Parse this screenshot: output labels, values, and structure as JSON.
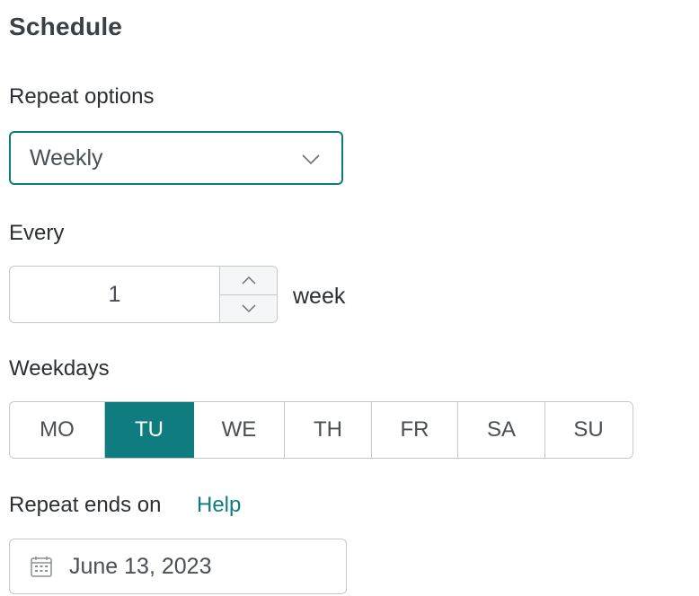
{
  "title": "Schedule",
  "repeat": {
    "label": "Repeat options",
    "selected": "Weekly",
    "icon": "chevron-down-icon"
  },
  "every": {
    "label": "Every",
    "value": "1",
    "unit": "week",
    "up_icon": "chevron-up-icon",
    "down_icon": "chevron-down-icon"
  },
  "weekdays": {
    "label": "Weekdays",
    "days": [
      {
        "label": "MO",
        "selected": false
      },
      {
        "label": "TU",
        "selected": true
      },
      {
        "label": "WE",
        "selected": false
      },
      {
        "label": "TH",
        "selected": false
      },
      {
        "label": "FR",
        "selected": false
      },
      {
        "label": "SA",
        "selected": false
      },
      {
        "label": "SU",
        "selected": false
      }
    ]
  },
  "ends": {
    "label": "Repeat ends on",
    "help": "Help",
    "date": "June 13, 2023",
    "icon": "calendar-icon"
  },
  "colors": {
    "accent": "#0f7c80",
    "border": "#c4c8cc",
    "text": "#2b2f33"
  }
}
